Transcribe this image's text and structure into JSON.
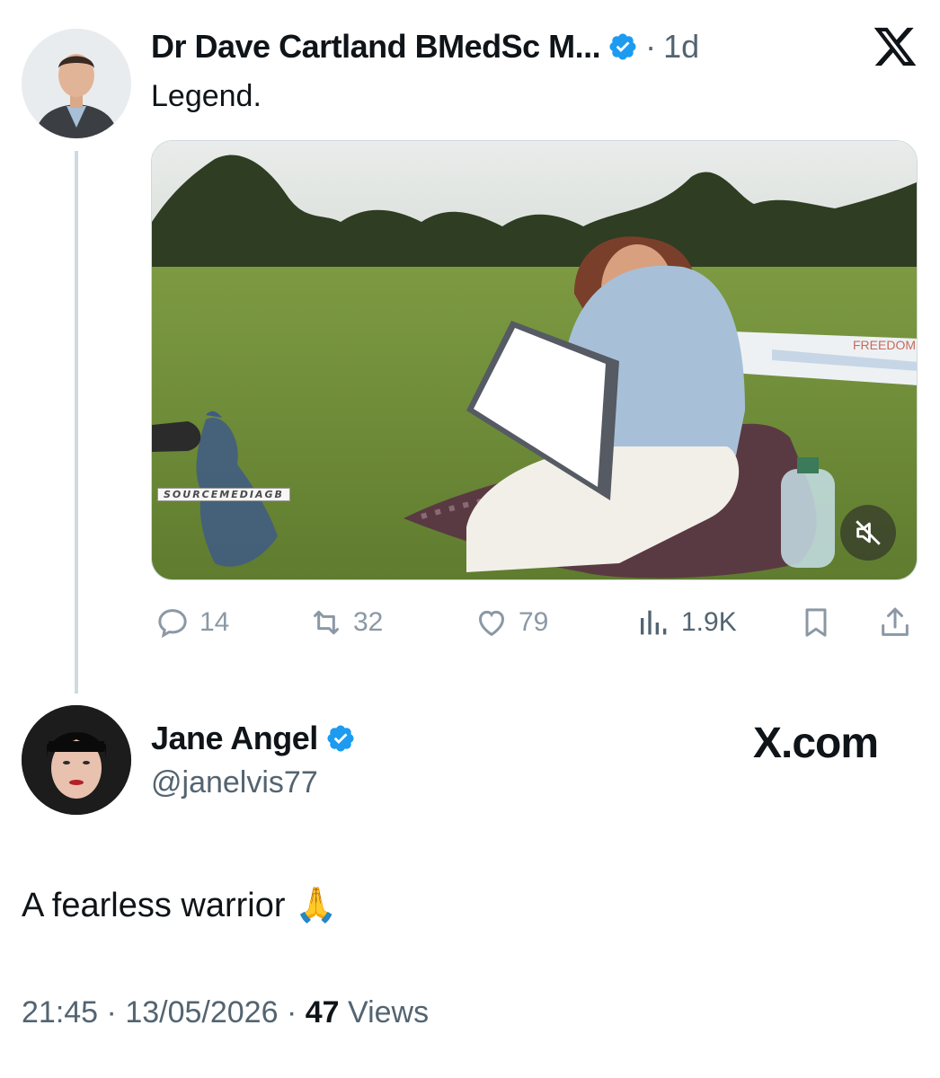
{
  "parent_tweet": {
    "display_name": "Dr Dave Cartland BMedSc M...",
    "separator": "·",
    "time_ago": "1d",
    "text": "Legend.",
    "platform_icon": "x-logo-icon",
    "media": {
      "watermark": "SOURCEMEDIAGB",
      "banner_text": "FREEDOM",
      "mute_icon": "volume-muted-icon"
    },
    "actions": {
      "replies": "14",
      "reposts": "32",
      "likes": "79",
      "views": "1.9K"
    }
  },
  "reply_tweet": {
    "display_name": "Jane Angel",
    "handle": "@janelvis77",
    "brand": "X.com",
    "text": "A fearless warrior",
    "emoji": "🙏",
    "time": "21:45",
    "date": "13/05/2026",
    "views_count": "47",
    "views_label": "Views"
  },
  "colors": {
    "verified": "#1d9bf0",
    "text_primary": "#0f1419",
    "text_secondary": "#536471",
    "thread_line": "#cfd9de"
  }
}
